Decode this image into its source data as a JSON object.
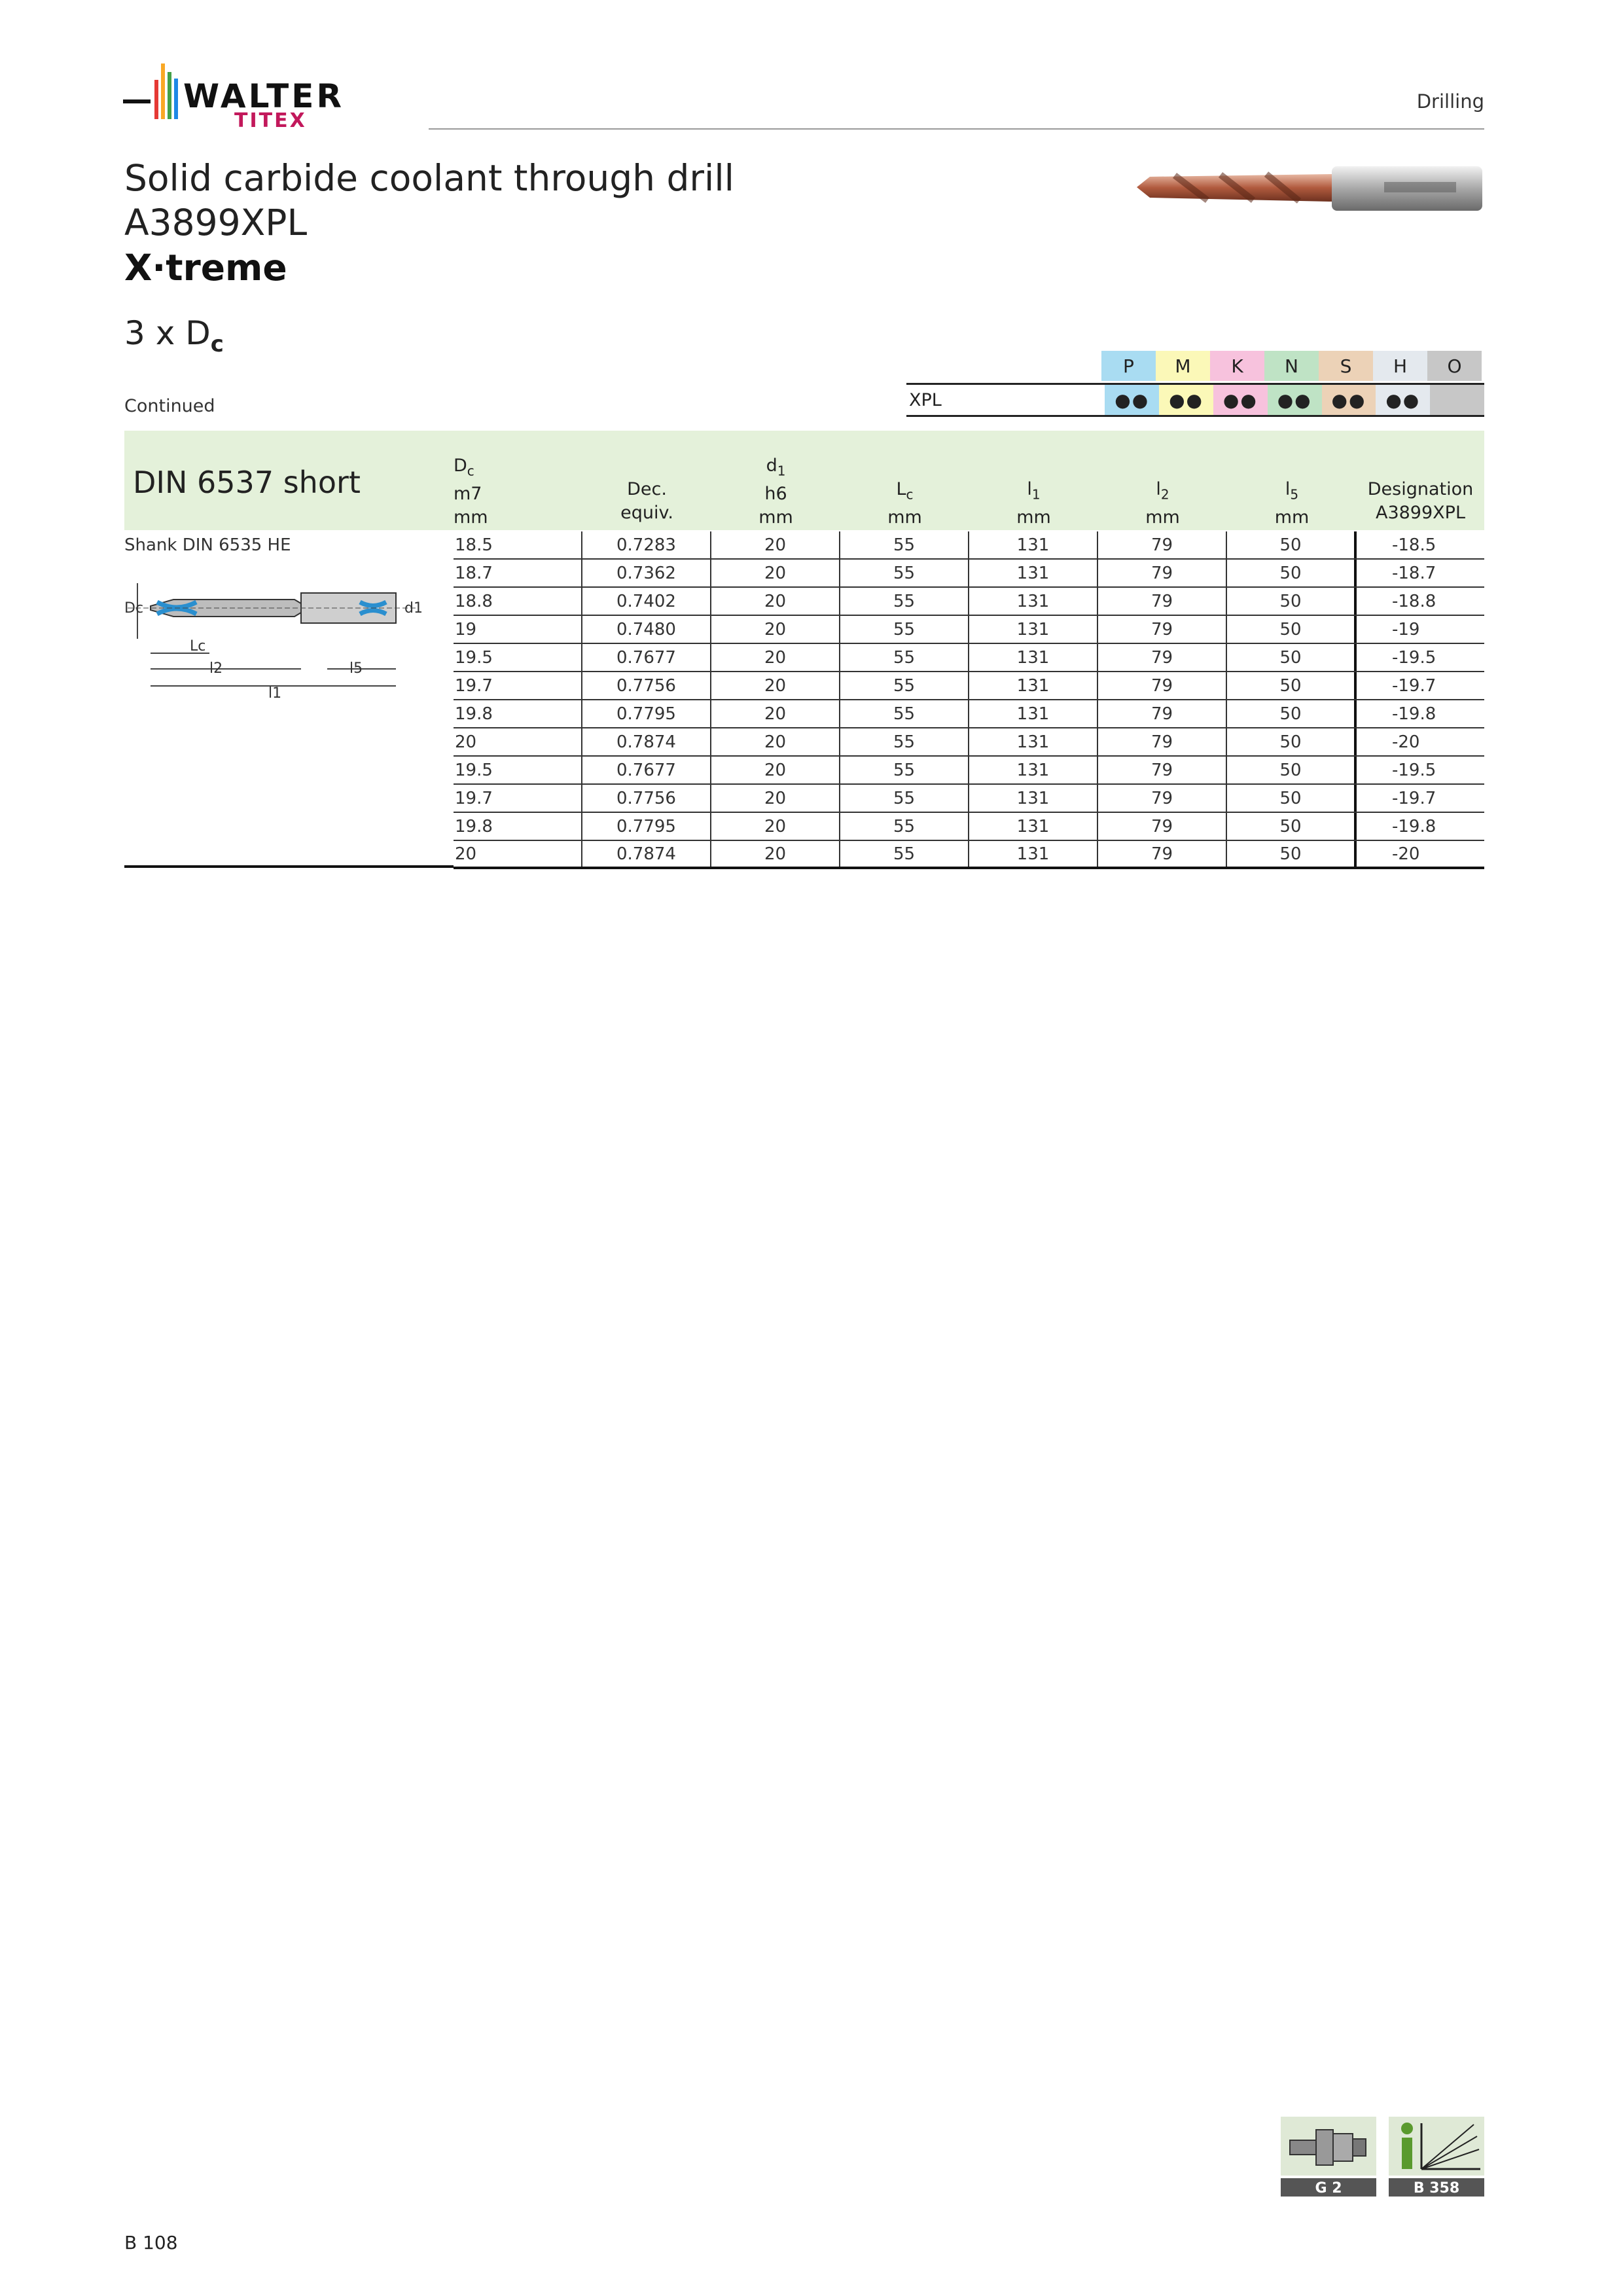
{
  "header": {
    "logo_main": "WALTER",
    "logo_sub": "TITEX",
    "section": "Drilling"
  },
  "product": {
    "title_line1": "Solid carbide coolant through drill",
    "title_line2": "A3899XPL",
    "title_line3": "X·treme",
    "ratio_prefix": "3 x D",
    "ratio_sub": "c"
  },
  "materials": {
    "groups": [
      {
        "letter": "P",
        "color": "#a9dcf2",
        "dots": "●●"
      },
      {
        "letter": "M",
        "color": "#fbf8b8",
        "dots": "●●"
      },
      {
        "letter": "K",
        "color": "#f7c2dd",
        "dots": "●●"
      },
      {
        "letter": "N",
        "color": "#bfe3c5",
        "dots": "●●"
      },
      {
        "letter": "S",
        "color": "#ecd2b7",
        "dots": "●●"
      },
      {
        "letter": "H",
        "color": "#e4e9ee",
        "dots": "●●"
      },
      {
        "letter": "O",
        "color": "#c7c7c7",
        "dots": ""
      }
    ],
    "grade": "XPL"
  },
  "continued": "Continued",
  "table": {
    "band_title": "DIN 6537 short",
    "shank_label": "Shank DIN 6535 HE",
    "headers": {
      "dc": {
        "sym": "D",
        "sub": "c",
        "l2": "m7",
        "l3": "mm"
      },
      "dec": {
        "l2": "Dec.",
        "l3": "equiv."
      },
      "d1": {
        "sym": "d",
        "sub": "1",
        "l2": "h6",
        "l3": "mm"
      },
      "lc": {
        "sym": "L",
        "sub": "c",
        "l3": "mm"
      },
      "l1": {
        "sym": "l",
        "sub": "1",
        "l3": "mm"
      },
      "l2": {
        "sym": "l",
        "sub": "2",
        "l3": "mm"
      },
      "l5": {
        "sym": "l",
        "sub": "5",
        "l3": "mm"
      },
      "designation": {
        "l2": "Designation",
        "l3": "A3899XPL"
      }
    },
    "rows": [
      [
        "18.5",
        "0.7283",
        "20",
        "55",
        "131",
        "79",
        "50",
        "-18.5"
      ],
      [
        "18.7",
        "0.7362",
        "20",
        "55",
        "131",
        "79",
        "50",
        "-18.7"
      ],
      [
        "18.8",
        "0.7402",
        "20",
        "55",
        "131",
        "79",
        "50",
        "-18.8"
      ],
      [
        "19",
        "0.7480",
        "20",
        "55",
        "131",
        "79",
        "50",
        "-19"
      ],
      [
        "19.5",
        "0.7677",
        "20",
        "55",
        "131",
        "79",
        "50",
        "-19.5"
      ],
      [
        "19.7",
        "0.7756",
        "20",
        "55",
        "131",
        "79",
        "50",
        "-19.7"
      ],
      [
        "19.8",
        "0.7795",
        "20",
        "55",
        "131",
        "79",
        "50",
        "-19.8"
      ],
      [
        "20",
        "0.7874",
        "20",
        "55",
        "131",
        "79",
        "50",
        "-20"
      ],
      [
        "19.5",
        "0.7677",
        "20",
        "55",
        "131",
        "79",
        "50",
        "-19.5"
      ],
      [
        "19.7",
        "0.7756",
        "20",
        "55",
        "131",
        "79",
        "50",
        "-19.7"
      ],
      [
        "19.8",
        "0.7795",
        "20",
        "55",
        "131",
        "79",
        "50",
        "-19.8"
      ],
      [
        "20",
        "0.7874",
        "20",
        "55",
        "131",
        "79",
        "50",
        "-20"
      ]
    ],
    "diagram_labels": {
      "dc": "Dc",
      "d1": "d1",
      "lc": "Lc",
      "l2": "l2",
      "l5": "l5",
      "l1": "l1"
    }
  },
  "footer": {
    "icon_left_label": "G 2",
    "icon_right_label": "B 358",
    "page_number": "B 108"
  }
}
